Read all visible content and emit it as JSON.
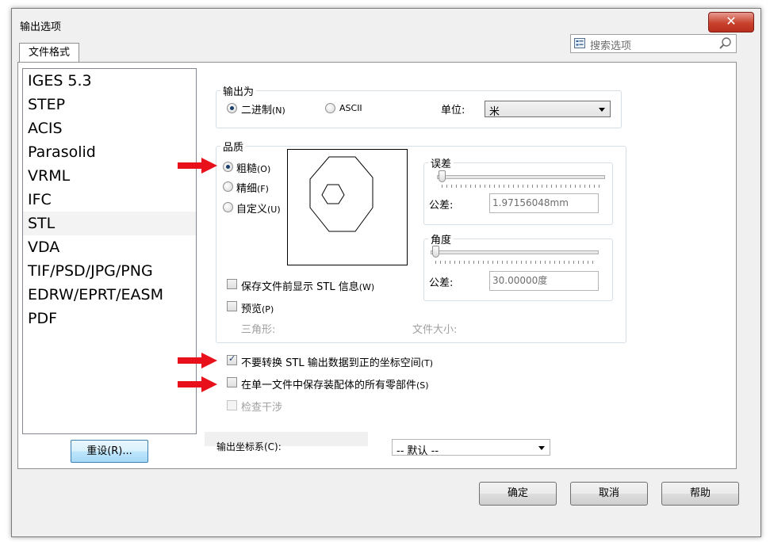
{
  "window": {
    "title": "输出选项",
    "close_glyph": "✕"
  },
  "tab": {
    "label": "文件格式"
  },
  "search": {
    "placeholder": "搜索选项"
  },
  "formats": [
    "IGES 5.3",
    "STEP",
    "ACIS",
    "Parasolid",
    "VRML",
    "IFC",
    "STL",
    "VDA",
    "TIF/PSD/JPG/PNG",
    "EDRW/EPRT/EASM",
    "PDF"
  ],
  "selected_format": "STL",
  "reset_button": "重设(R)...",
  "output_as": {
    "legend": "输出为",
    "binary_label": "二进制",
    "binary_key": "(N)",
    "ascii_label": "ASCII",
    "selected": "binary",
    "unit_label": "单位:",
    "unit_value": "米"
  },
  "quality": {
    "legend": "品质",
    "options": [
      {
        "label": "粗糙",
        "key": "(O)",
        "selected": true
      },
      {
        "label": "精细",
        "key": "(F)",
        "selected": false
      },
      {
        "label": "自定义",
        "key": "(U)",
        "selected": false
      }
    ],
    "deviation": {
      "legend": "误差",
      "tol_label": "公差:",
      "tol_value": "1.97156048mm",
      "slider_level": 0
    },
    "angle": {
      "legend": "角度",
      "tol_label": "公差:",
      "tol_value": "30.00000度",
      "slider_level": 0
    },
    "show_stl_info": {
      "label": "保存文件前显示 STL 信息",
      "key": "(W)",
      "checked": false
    },
    "preview": {
      "label": "预览",
      "key": "(P)",
      "checked": false
    },
    "triangles_label": "三角形:",
    "file_size_label": "文件大小:"
  },
  "options": [
    {
      "label": "不要转换 STL 输出数据到正的坐标空间",
      "key": "(T)",
      "checked": true,
      "enabled": true,
      "marked": true
    },
    {
      "label": "在单一文件中保存装配体的所有零部件",
      "key": "(S)",
      "checked": false,
      "enabled": true,
      "marked": true
    },
    {
      "label": "检查干涉",
      "key": "",
      "checked": false,
      "enabled": false,
      "marked": false
    }
  ],
  "coord_system": {
    "label": "输出坐标系(C):",
    "value": "-- 默认 --"
  },
  "buttons": {
    "ok": "确定",
    "cancel": "取消",
    "help": "帮助"
  },
  "colors": {
    "arrow": "#e8101a",
    "button_border_focus": "#3c7fb1",
    "close_red": "#c9422e"
  },
  "icons": {
    "arrow": "red-arrow-icon",
    "search": "magnifier-icon"
  }
}
